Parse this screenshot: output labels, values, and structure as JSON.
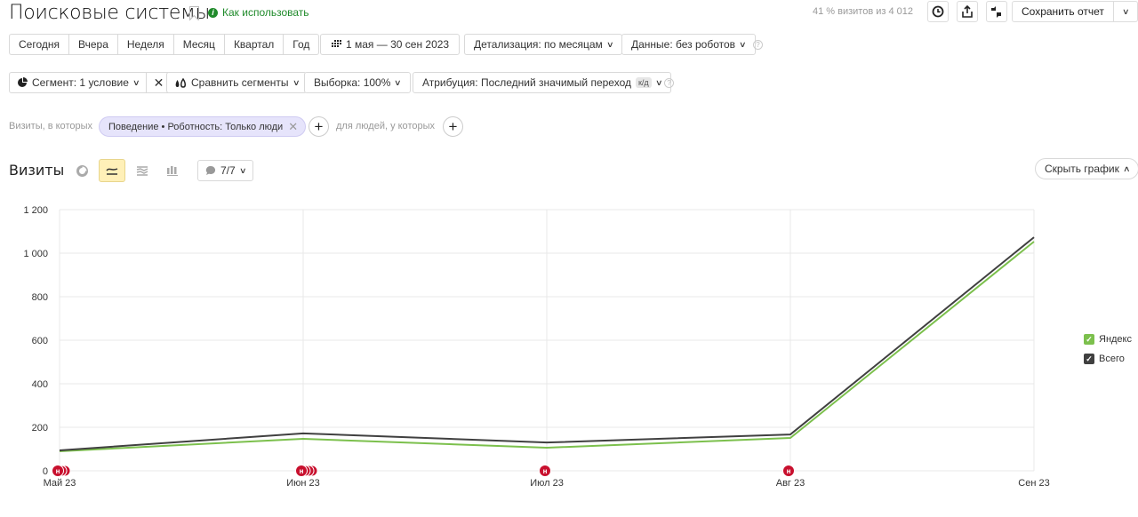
{
  "header": {
    "title": "Поисковые системы",
    "how_to_use": "Как использовать",
    "visits_share": "41 % визитов из 4 012",
    "save_report": "Сохранить отчет",
    "icons": [
      "history-icon",
      "export-icon",
      "compare-icon"
    ]
  },
  "period_presets": [
    "Сегодня",
    "Вчера",
    "Неделя",
    "Месяц",
    "Квартал",
    "Год"
  ],
  "date_range": "1 мая — 30 сен 2023",
  "detail": "Детализация: по месяцам",
  "data_mode": "Данные: без роботов",
  "segment": "Сегмент: 1 условие",
  "compare_segments": "Сравнить сегменты",
  "sample": "Выборка: 100%",
  "attribution": "Атрибуция: Последний значимый переход",
  "attribution_badge": "к/д",
  "filters": {
    "visits_label": "Визиты, в которых",
    "chip": "Поведение • Роботность: Только люди",
    "people_label": "для людей, у которых"
  },
  "chart_section": {
    "title": "Визиты",
    "notes": "7/7",
    "hide_chart": "Скрыть график",
    "active_view": "line"
  },
  "chart_data": {
    "type": "line",
    "title": "Визиты",
    "categories": [
      "Май 23",
      "Июн 23",
      "Июл 23",
      "Авг 23",
      "Сен 23"
    ],
    "series": [
      {
        "name": "Яндекс",
        "color": "#7cc04d",
        "values": [
          90,
          147,
          106,
          151,
          1053
        ]
      },
      {
        "name": "Всего",
        "color": "#404040",
        "values": [
          94,
          172,
          130,
          167,
          1073
        ]
      }
    ],
    "yticks": [
      "0",
      "200",
      "400",
      "600",
      "800",
      "1 000",
      "1 200"
    ],
    "ylim": [
      0,
      1200
    ],
    "grid": true,
    "legend": "right",
    "annotations": [
      {
        "category": "Май 23",
        "count": 3,
        "label": "н"
      },
      {
        "category": "Июн 23",
        "count": 4,
        "label": "н"
      },
      {
        "category": "Июл 23",
        "count": 1,
        "label": "н"
      },
      {
        "category": "Авг 23",
        "count": 1,
        "label": "н"
      }
    ]
  }
}
